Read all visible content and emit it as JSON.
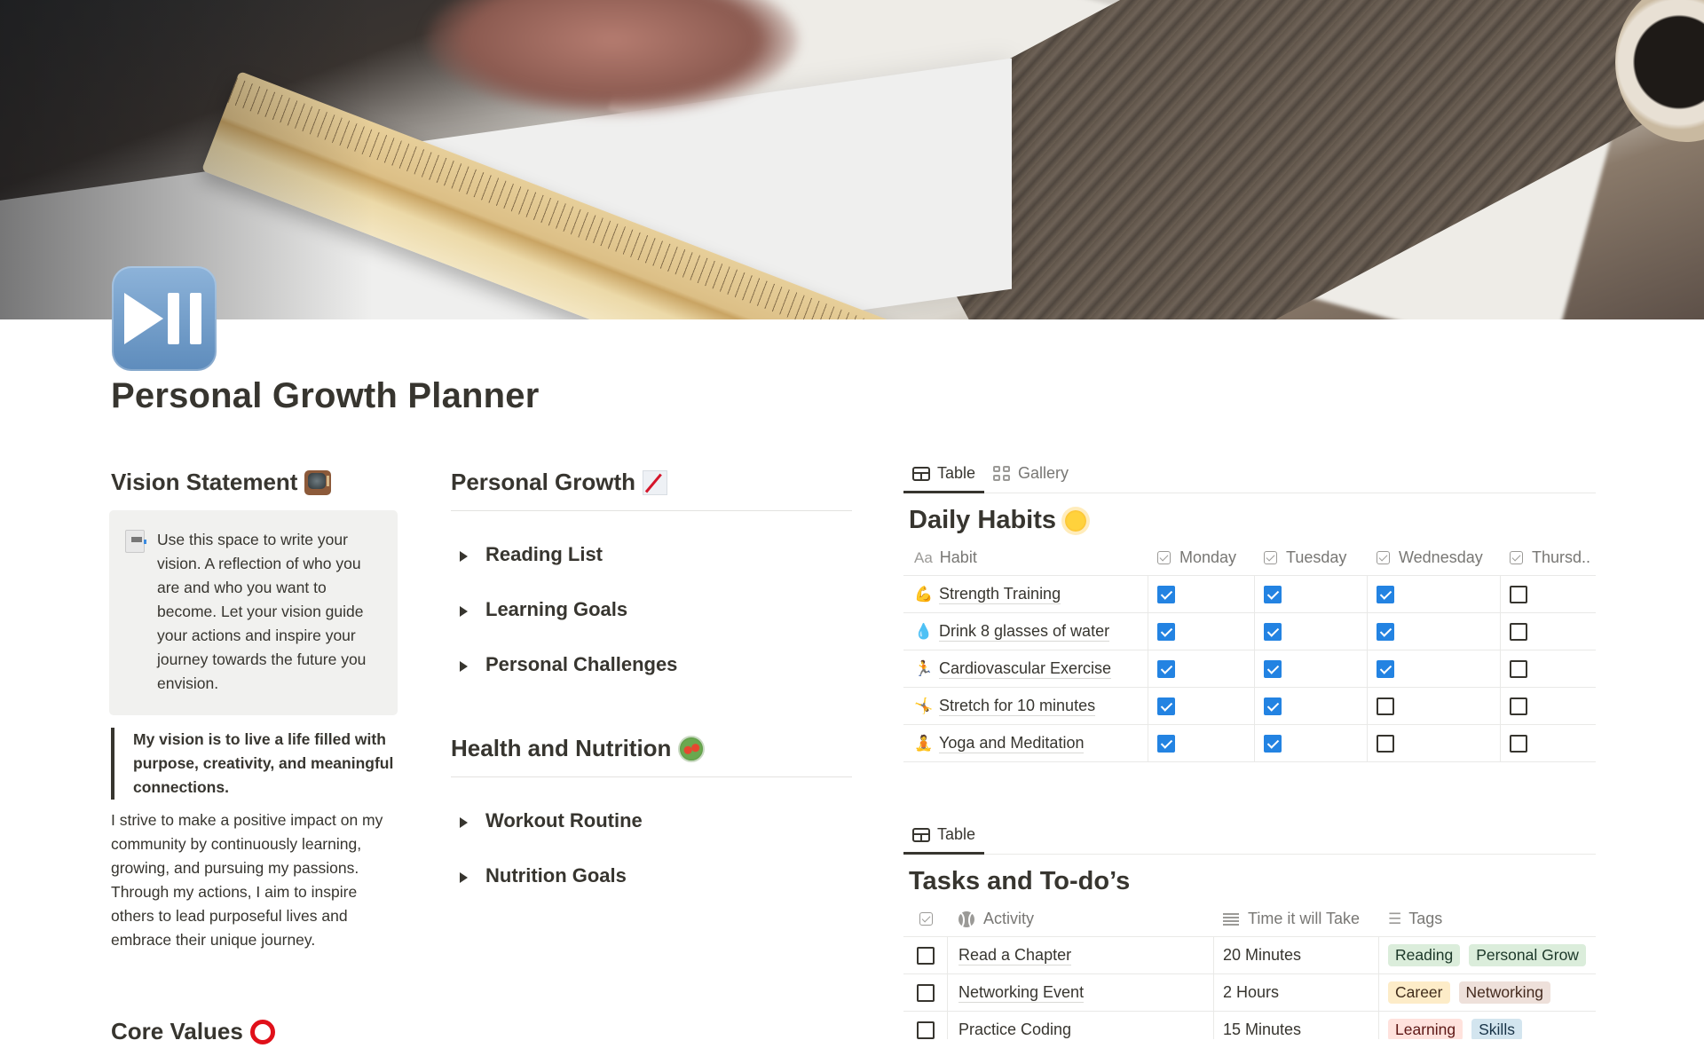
{
  "page": {
    "title": "Personal Growth Planner",
    "icon": "play-pause-icon"
  },
  "vision": {
    "heading": "Vision Statement",
    "heading_icon": "tv-icon",
    "callout_icon": "document-icon",
    "callout_text": "Use this space to write your vision. A reflection of who you are and who you want to become. Let your vision guide your actions and inspire your journey towards the future you envision.",
    "quote": "My vision is to live a life filled with purpose, creativity, and meaningful connections.",
    "paragraph": "I strive to make a positive impact on my community by continuously learning, growing, and pursuing my passions. Through my actions, I aim to inspire others to lead purposeful lives and embrace their unique journey."
  },
  "core_values": {
    "heading": "Core Values",
    "heading_icon": "red-ring-icon"
  },
  "personal_growth": {
    "heading": "Personal Growth",
    "heading_icon": "chart-increasing-icon",
    "toggles": [
      "Reading List",
      "Learning Goals",
      "Personal Challenges"
    ]
  },
  "health": {
    "heading": "Health and Nutrition",
    "heading_icon": "salad-icon",
    "toggles": [
      "Workout Routine",
      "Nutrition Goals"
    ]
  },
  "habits_db": {
    "views": [
      {
        "label": "Table",
        "icon": "table-icon",
        "active": true
      },
      {
        "label": "Gallery",
        "icon": "gallery-icon",
        "active": false
      }
    ],
    "title": "Daily Habits",
    "title_icon": "sun-icon",
    "columns": {
      "habit": "Habit",
      "habit_icon": "Aa",
      "days": [
        "Monday",
        "Tuesday",
        "Wednesday",
        "Thursd.."
      ]
    },
    "rows": [
      {
        "emoji": "💪",
        "name": "Strength Training",
        "checks": [
          true,
          true,
          true,
          false
        ]
      },
      {
        "emoji": "💧",
        "name": "Drink 8 glasses of water",
        "checks": [
          true,
          true,
          true,
          false
        ]
      },
      {
        "emoji": "🏃",
        "name": "Cardiovascular Exercise",
        "checks": [
          true,
          true,
          true,
          false
        ]
      },
      {
        "emoji": "🤸",
        "name": "Stretch for 10 minutes",
        "checks": [
          true,
          true,
          false,
          false
        ]
      },
      {
        "emoji": "🧘",
        "name": "Yoga and Meditation",
        "checks": [
          true,
          true,
          false,
          false
        ]
      }
    ]
  },
  "tasks_db": {
    "views": [
      {
        "label": "Table",
        "icon": "table-icon",
        "active": true
      }
    ],
    "title": "Tasks and To-do’s",
    "columns": {
      "activity": "Activity",
      "time": "Time it will Take",
      "tags": "Tags"
    },
    "rows": [
      {
        "done": false,
        "activity": "Read a Chapter",
        "time": "20 Minutes",
        "tags": [
          {
            "label": "Reading",
            "bg": "#dbeddb",
            "fg": "#1c3829"
          },
          {
            "label": "Personal Grow",
            "bg": "#dbeddb",
            "fg": "#1c3829"
          }
        ]
      },
      {
        "done": false,
        "activity": "Networking Event",
        "time": "2 Hours",
        "tags": [
          {
            "label": "Career",
            "bg": "#fdecc8",
            "fg": "#402c1b"
          },
          {
            "label": "Networking",
            "bg": "#eee0da",
            "fg": "#442a1e"
          }
        ]
      },
      {
        "done": false,
        "activity": "Practice Coding",
        "time": "15 Minutes",
        "tags": [
          {
            "label": "Learning",
            "bg": "#ffe2dd",
            "fg": "#5d1715"
          },
          {
            "label": "Skills",
            "bg": "#d3e5ef",
            "fg": "#183347"
          }
        ]
      }
    ]
  },
  "colors": {
    "text": "#37352f",
    "muted": "#787774",
    "checkbox_on": "#2383e2",
    "callout_bg": "#f1f1ef"
  }
}
